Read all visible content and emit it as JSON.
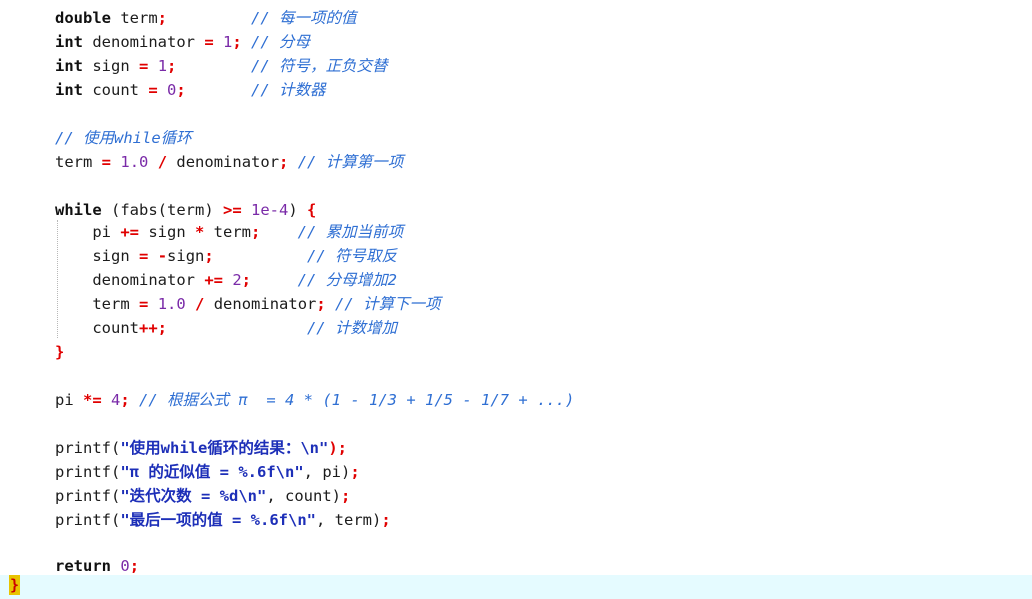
{
  "editor": {
    "lines": [
      [
        {
          "t": "double",
          "c": "kw"
        },
        {
          "t": " term",
          "c": "plain"
        },
        {
          "t": ";",
          "c": "op"
        },
        {
          "t": "         // 每一项的值",
          "c": "cmt"
        }
      ],
      [
        {
          "t": "int",
          "c": "kw"
        },
        {
          "t": " denominator ",
          "c": "plain"
        },
        {
          "t": "=",
          "c": "op"
        },
        {
          "t": " ",
          "c": "plain"
        },
        {
          "t": "1",
          "c": "num"
        },
        {
          "t": ";",
          "c": "op"
        },
        {
          "t": " // 分母",
          "c": "cmt"
        }
      ],
      [
        {
          "t": "int",
          "c": "kw"
        },
        {
          "t": " sign ",
          "c": "plain"
        },
        {
          "t": "=",
          "c": "op"
        },
        {
          "t": " ",
          "c": "plain"
        },
        {
          "t": "1",
          "c": "num"
        },
        {
          "t": ";",
          "c": "op"
        },
        {
          "t": "        // 符号，正负交替",
          "c": "cmt"
        }
      ],
      [
        {
          "t": "int",
          "c": "kw"
        },
        {
          "t": " count ",
          "c": "plain"
        },
        {
          "t": "=",
          "c": "op"
        },
        {
          "t": " ",
          "c": "plain"
        },
        {
          "t": "0",
          "c": "num"
        },
        {
          "t": ";",
          "c": "op"
        },
        {
          "t": "       // 计数器",
          "c": "cmt"
        }
      ],
      [],
      [
        {
          "t": "// 使用while循环",
          "c": "cmt"
        }
      ],
      [
        {
          "t": "term ",
          "c": "plain"
        },
        {
          "t": "=",
          "c": "op"
        },
        {
          "t": " ",
          "c": "plain"
        },
        {
          "t": "1.0",
          "c": "num"
        },
        {
          "t": " ",
          "c": "plain"
        },
        {
          "t": "/",
          "c": "op"
        },
        {
          "t": " denominator",
          "c": "plain"
        },
        {
          "t": ";",
          "c": "op"
        },
        {
          "t": " // 计算第一项",
          "c": "cmt"
        }
      ],
      [],
      [
        {
          "t": "while",
          "c": "kw"
        },
        {
          "t": " (fabs(term) ",
          "c": "plain"
        },
        {
          "t": ">=",
          "c": "op"
        },
        {
          "t": " ",
          "c": "plain"
        },
        {
          "t": "1e-4",
          "c": "num"
        },
        {
          "t": ") ",
          "c": "plain"
        },
        {
          "t": "{",
          "c": "op"
        }
      ],
      [
        {
          "t": "    pi ",
          "c": "plain"
        },
        {
          "t": "+=",
          "c": "op"
        },
        {
          "t": " sign ",
          "c": "plain"
        },
        {
          "t": "*",
          "c": "op"
        },
        {
          "t": " term",
          "c": "plain"
        },
        {
          "t": ";",
          "c": "op"
        },
        {
          "t": "    // 累加当前项",
          "c": "cmt"
        }
      ],
      [
        {
          "t": "    sign ",
          "c": "plain"
        },
        {
          "t": "=",
          "c": "op"
        },
        {
          "t": " ",
          "c": "plain"
        },
        {
          "t": "-",
          "c": "op"
        },
        {
          "t": "sign",
          "c": "plain"
        },
        {
          "t": ";",
          "c": "op"
        },
        {
          "t": "          // 符号取反",
          "c": "cmt"
        }
      ],
      [
        {
          "t": "    denominator ",
          "c": "plain"
        },
        {
          "t": "+=",
          "c": "op"
        },
        {
          "t": " ",
          "c": "plain"
        },
        {
          "t": "2",
          "c": "num"
        },
        {
          "t": ";",
          "c": "op"
        },
        {
          "t": "     // 分母增加2",
          "c": "cmt"
        }
      ],
      [
        {
          "t": "    term ",
          "c": "plain"
        },
        {
          "t": "=",
          "c": "op"
        },
        {
          "t": " ",
          "c": "plain"
        },
        {
          "t": "1.0",
          "c": "num"
        },
        {
          "t": " ",
          "c": "plain"
        },
        {
          "t": "/",
          "c": "op"
        },
        {
          "t": " denominator",
          "c": "plain"
        },
        {
          "t": ";",
          "c": "op"
        },
        {
          "t": " // 计算下一项",
          "c": "cmt"
        }
      ],
      [
        {
          "t": "    count",
          "c": "plain"
        },
        {
          "t": "++;",
          "c": "op"
        },
        {
          "t": "               // 计数增加",
          "c": "cmt"
        }
      ],
      [
        {
          "t": "}",
          "c": "op"
        }
      ],
      [],
      [
        {
          "t": "pi ",
          "c": "plain"
        },
        {
          "t": "*=",
          "c": "op"
        },
        {
          "t": " ",
          "c": "plain"
        },
        {
          "t": "4",
          "c": "num"
        },
        {
          "t": ";",
          "c": "op"
        },
        {
          "t": " // 根据公式 π  = 4 * (1 - 1/3 + 1/5 - 1/7 + ...)",
          "c": "cmt"
        }
      ],
      [],
      [
        {
          "t": "printf(",
          "c": "plain"
        },
        {
          "t": "\"使用while循环的结果：",
          "c": "str"
        },
        {
          "t": "\\n",
          "c": "esc"
        },
        {
          "t": "\"",
          "c": "str"
        },
        {
          "t": ");",
          "c": "op"
        }
      ],
      [
        {
          "t": "printf(",
          "c": "plain"
        },
        {
          "t": "\"π 的近似值 = %.6f",
          "c": "str"
        },
        {
          "t": "\\n",
          "c": "esc"
        },
        {
          "t": "\"",
          "c": "str"
        },
        {
          "t": ", pi)",
          "c": "plain"
        },
        {
          "t": ";",
          "c": "op"
        }
      ],
      [
        {
          "t": "printf(",
          "c": "plain"
        },
        {
          "t": "\"迭代次数 = %d",
          "c": "str"
        },
        {
          "t": "\\n",
          "c": "esc"
        },
        {
          "t": "\"",
          "c": "str"
        },
        {
          "t": ", count)",
          "c": "plain"
        },
        {
          "t": ";",
          "c": "op"
        }
      ],
      [
        {
          "t": "printf(",
          "c": "plain"
        },
        {
          "t": "\"最后一项的值 = %.6f",
          "c": "str"
        },
        {
          "t": "\\n",
          "c": "esc"
        },
        {
          "t": "\"",
          "c": "str"
        },
        {
          "t": ", term)",
          "c": "plain"
        },
        {
          "t": ";",
          "c": "op"
        }
      ],
      [],
      [
        {
          "t": "return",
          "c": "kw"
        },
        {
          "t": " ",
          "c": "plain"
        },
        {
          "t": "0",
          "c": "num"
        },
        {
          "t": ";",
          "c": "op"
        }
      ],
      []
    ],
    "closing_brace": "}"
  }
}
